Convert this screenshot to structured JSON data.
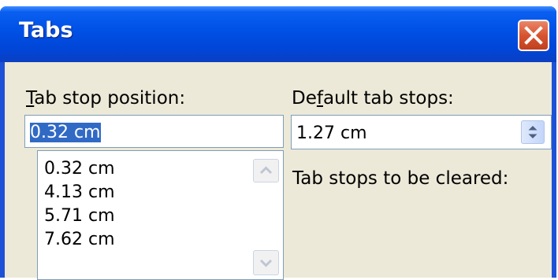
{
  "dialog": {
    "title": "Tabs",
    "close_icon": "close-icon"
  },
  "tab_stop_position": {
    "label_prefix": "",
    "label_accel": "T",
    "label_rest": "ab stop position:",
    "value": "0.32 cm",
    "items": [
      "0.32 cm",
      "4.13 cm",
      "5.71 cm",
      "7.62 cm"
    ],
    "scroll_up_icon": "scroll-up-icon",
    "scroll_down_icon": "scroll-down-icon"
  },
  "default_tab_stops": {
    "label_prefix": "De",
    "label_accel": "f",
    "label_rest": "ault tab stops:",
    "value": "1.27 cm",
    "spin_icon": "spin-updown-icon"
  },
  "tab_stops_cleared": {
    "label": "Tab stops to be cleared:"
  },
  "colors": {
    "title_bar": "#0052e6",
    "close_button": "#d8542f",
    "dialog_face": "#ece9d8",
    "selection": "#316ac5"
  }
}
